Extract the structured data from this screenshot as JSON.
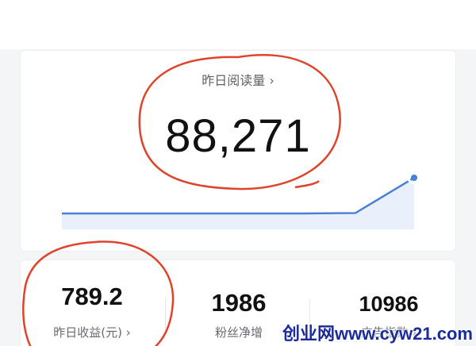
{
  "reads": {
    "label": "昨日阅读量 ›",
    "value": "88,271"
  },
  "trend": {
    "values": [
      1,
      1,
      1,
      1,
      1,
      1.05,
      5
    ],
    "line_color": "#4a7fd4",
    "fill_color": "#e9f0fb"
  },
  "stats": [
    {
      "value": "789.2",
      "label": "昨日收益(元) ›"
    },
    {
      "value": "1986",
      "label": "粉丝净增"
    },
    {
      "value": "10986",
      "label": "广告指数 ›"
    }
  ],
  "annotation_color": "#e0432b",
  "watermark": "创业网www.cyw21.com"
}
